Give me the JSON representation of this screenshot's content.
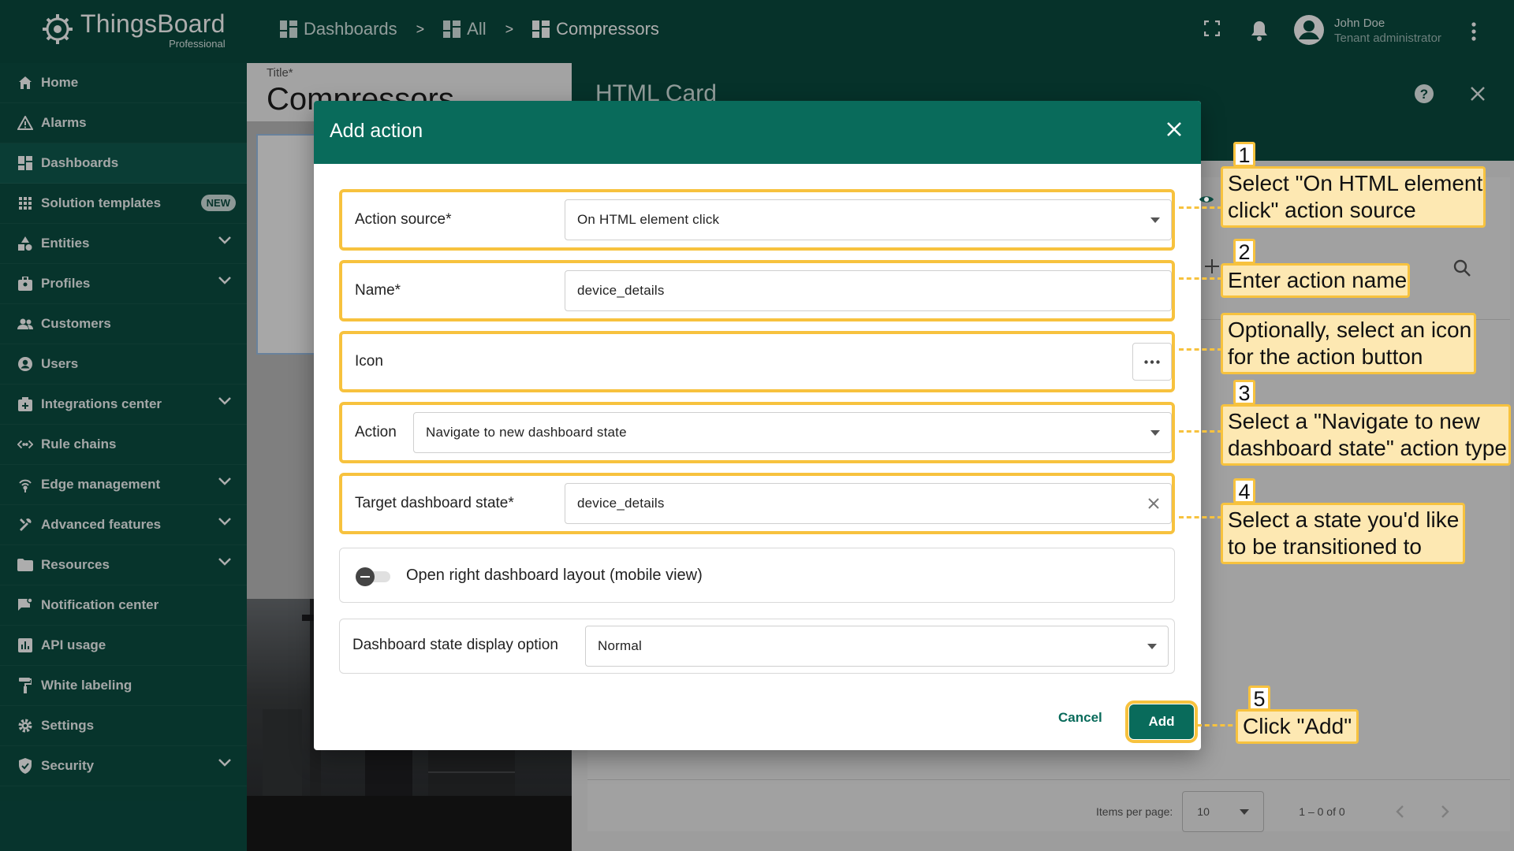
{
  "app": {
    "name": "ThingsBoard",
    "edition": "Professional"
  },
  "breadcrumbs": [
    {
      "label": "Dashboards"
    },
    {
      "label": "All"
    },
    {
      "label": "Compressors"
    }
  ],
  "breadcrumb_separator": ">",
  "user": {
    "name": "John Doe",
    "role": "Tenant administrator"
  },
  "sidebar": {
    "items": [
      {
        "label": "Home",
        "icon": "home-icon"
      },
      {
        "label": "Alarms",
        "icon": "alarm-icon"
      },
      {
        "label": "Dashboards",
        "icon": "dashboards-icon",
        "active": true
      },
      {
        "label": "Solution templates",
        "icon": "grid-icon",
        "badge": "NEW"
      },
      {
        "label": "Entities",
        "icon": "entities-icon",
        "expandable": true
      },
      {
        "label": "Profiles",
        "icon": "profiles-icon",
        "expandable": true
      },
      {
        "label": "Customers",
        "icon": "customers-icon"
      },
      {
        "label": "Users",
        "icon": "user-icon"
      },
      {
        "label": "Integrations center",
        "icon": "integrations-icon",
        "expandable": true
      },
      {
        "label": "Rule chains",
        "icon": "rule-chains-icon"
      },
      {
        "label": "Edge management",
        "icon": "edge-icon",
        "expandable": true
      },
      {
        "label": "Advanced features",
        "icon": "tools-icon",
        "expandable": true
      },
      {
        "label": "Resources",
        "icon": "folder-icon",
        "expandable": true
      },
      {
        "label": "Notification center",
        "icon": "notification-icon"
      },
      {
        "label": "API usage",
        "icon": "api-usage-icon"
      },
      {
        "label": "White labeling",
        "icon": "paint-roller-icon"
      },
      {
        "label": "Settings",
        "icon": "settings-icon"
      },
      {
        "label": "Security",
        "icon": "security-icon",
        "expandable": true
      }
    ]
  },
  "background": {
    "title_label": "Title*",
    "title_value": "Compressors",
    "widget_title": "HTML Card",
    "pager": {
      "items_per_page_label": "Items per page:",
      "items_per_page": "10",
      "range": "1 – 0 of 0"
    }
  },
  "dialog": {
    "title": "Add action",
    "fields": {
      "action_source": {
        "label": "Action source*",
        "value": "On HTML element click"
      },
      "name": {
        "label": "Name*",
        "value": "device_details"
      },
      "icon": {
        "label": "Icon"
      },
      "action": {
        "label": "Action",
        "value": "Navigate to new dashboard state"
      },
      "target_state": {
        "label": "Target dashboard state*",
        "value": "device_details"
      },
      "open_right_layout": {
        "label": "Open right dashboard layout (mobile view)",
        "checked": false
      },
      "display_option": {
        "label": "Dashboard state display option",
        "value": "Normal"
      }
    },
    "cancel_label": "Cancel",
    "add_label": "Add"
  },
  "callouts": [
    {
      "number": "1",
      "lines": [
        "Select \"On HTML element",
        "click\" action source"
      ]
    },
    {
      "number": "2",
      "lines": [
        "Enter action name"
      ]
    },
    {
      "number": "",
      "lines": [
        "Optionally, select an icon",
        "for the action button"
      ]
    },
    {
      "number": "3",
      "lines": [
        "Select a \"Navigate to new",
        "dashboard state\" action type"
      ]
    },
    {
      "number": "4",
      "lines": [
        "Select a state you'd like",
        "to be transitioned to"
      ]
    },
    {
      "number": "5",
      "lines": [
        "Click \"Add\""
      ]
    }
  ],
  "colors": {
    "primary": "#096b5b",
    "topbar": "#0a4a3f",
    "sidebar": "#0b4d42",
    "highlight": "#f7c23e",
    "callout_fill": "#fde8b2"
  }
}
